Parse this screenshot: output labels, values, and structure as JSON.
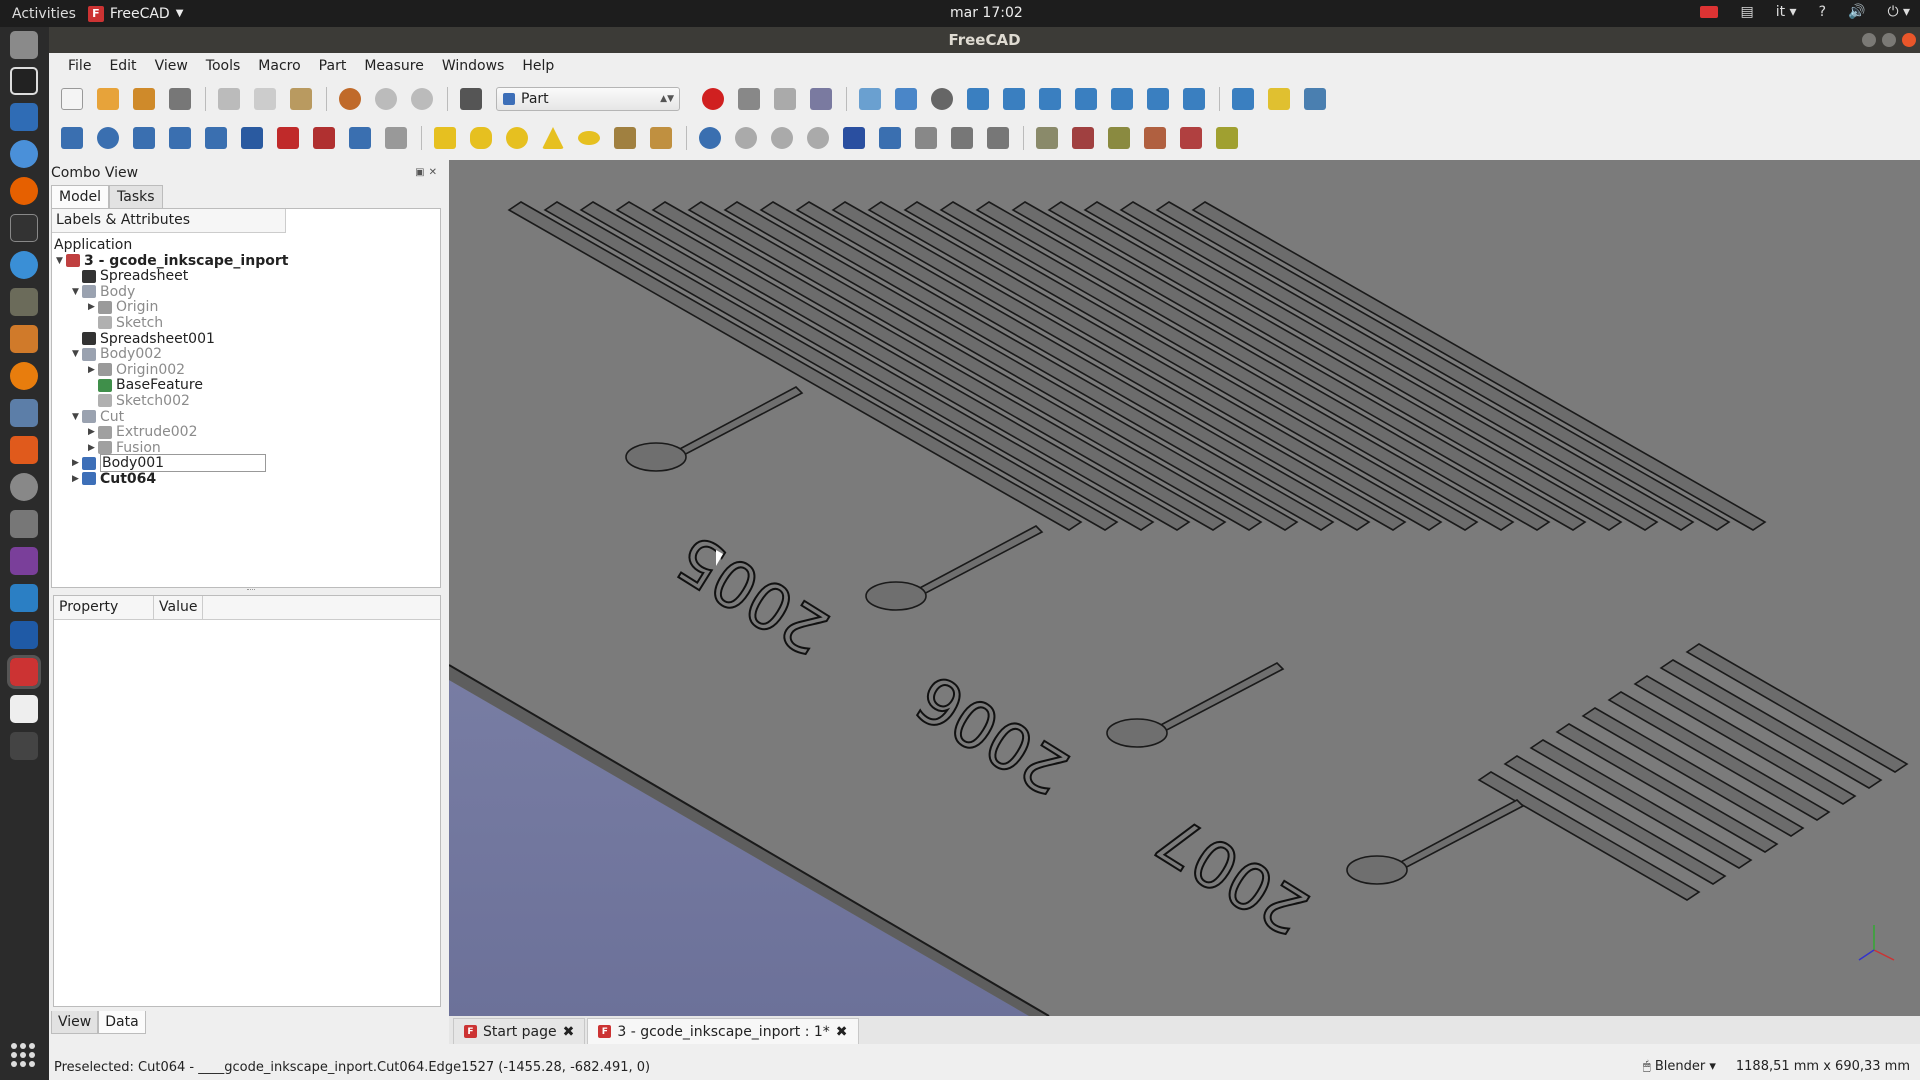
{
  "system": {
    "activities": "Activities",
    "app_name": "FreeCAD",
    "clock": "mar 17:02",
    "lang": "it",
    "help": "?"
  },
  "window": {
    "title": "FreeCAD"
  },
  "menubar": [
    "File",
    "Edit",
    "View",
    "Tools",
    "Macro",
    "Part",
    "Measure",
    "Windows",
    "Help"
  ],
  "workbench": {
    "selected": "Part"
  },
  "combo": {
    "title": "Combo View",
    "tabs": [
      "Model",
      "Tasks"
    ],
    "tree_header": "Labels & Attributes",
    "tree_root": "Application",
    "tree": [
      {
        "label": "3 - gcode_inkscape_inport",
        "depth": 1,
        "exp": "open",
        "style": "bold",
        "icon": "document-icon",
        "color": "#c04040"
      },
      {
        "label": "Spreadsheet",
        "depth": 2,
        "exp": "",
        "style": "",
        "icon": "spreadsheet-icon",
        "color": "#333333"
      },
      {
        "label": "Body",
        "depth": 2,
        "exp": "open",
        "style": "dim",
        "icon": "body-icon",
        "color": "#9aa2b0"
      },
      {
        "label": "Origin",
        "depth": 3,
        "exp": "closed",
        "style": "dim",
        "icon": "origin-icon",
        "color": "#9a9a9a"
      },
      {
        "label": "Sketch",
        "depth": 3,
        "exp": "",
        "style": "dim",
        "icon": "sketch-icon",
        "color": "#b0b0b0"
      },
      {
        "label": "Spreadsheet001",
        "depth": 2,
        "exp": "",
        "style": "",
        "icon": "spreadsheet-icon",
        "color": "#333333"
      },
      {
        "label": "Body002",
        "depth": 2,
        "exp": "open",
        "style": "dim",
        "icon": "body-icon",
        "color": "#9aa2b0"
      },
      {
        "label": "Origin002",
        "depth": 3,
        "exp": "closed",
        "style": "dim",
        "icon": "origin-icon",
        "color": "#9a9a9a"
      },
      {
        "label": "BaseFeature",
        "depth": 3,
        "exp": "",
        "style": "",
        "icon": "base-feature-icon",
        "color": "#3f8f4a"
      },
      {
        "label": "Sketch002",
        "depth": 3,
        "exp": "",
        "style": "dim",
        "icon": "sketch-icon",
        "color": "#b0b0b0"
      },
      {
        "label": "Cut",
        "depth": 2,
        "exp": "open",
        "style": "dim",
        "icon": "cut-icon",
        "color": "#9aa2b0"
      },
      {
        "label": "Extrude002",
        "depth": 3,
        "exp": "closed",
        "style": "dim",
        "icon": "extrude-icon",
        "color": "#a0a0a0"
      },
      {
        "label": "Fusion",
        "depth": 3,
        "exp": "closed",
        "style": "dim",
        "icon": "fusion-icon",
        "color": "#a0a0a0"
      },
      {
        "label": "Body001",
        "depth": 2,
        "exp": "closed",
        "style": "edit",
        "icon": "body-icon",
        "color": "#3d6fb8"
      },
      {
        "label": "Cut064",
        "depth": 2,
        "exp": "closed",
        "style": "bold",
        "icon": "cut-icon",
        "color": "#3d6fb8"
      }
    ],
    "property_header": [
      "Property",
      "Value"
    ],
    "bottom_tabs": [
      "View",
      "Data"
    ]
  },
  "doc_tabs": [
    {
      "label": "Start page",
      "active": false
    },
    {
      "label": "3 - gcode_inkscape_inport : 1*",
      "active": true
    }
  ],
  "view3d": {
    "labels": [
      "2005",
      "2006",
      "2007"
    ],
    "colors": {
      "plate": "#7b7b7b",
      "background_bottom": "#6f74a0",
      "edges": "#1a1a1a"
    }
  },
  "statusbar": {
    "message": "Preselected: Cut064 - ____gcode_inkscape_inport.Cut064.Edge1527 (-1455.28, -682.491, 0)",
    "nav_style": "Blender",
    "dimensions": "1188,51 mm x 690,33 mm"
  }
}
